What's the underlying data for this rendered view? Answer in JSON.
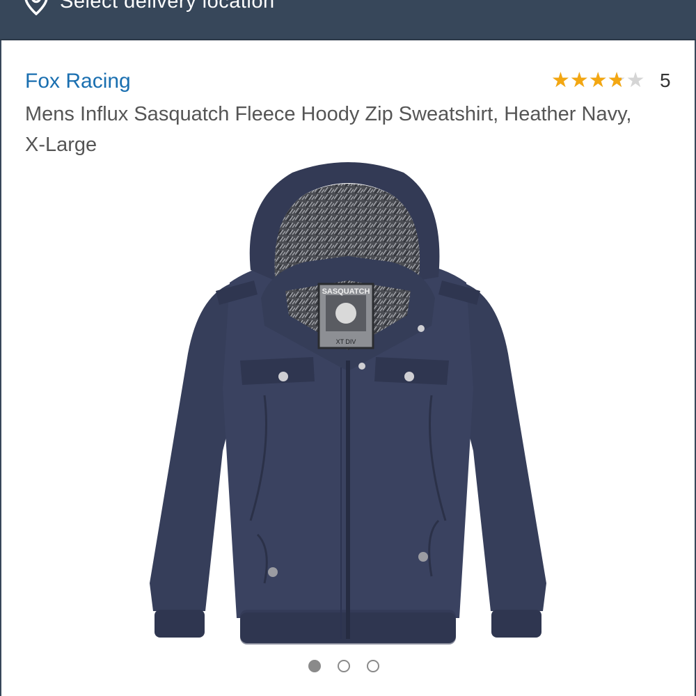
{
  "header": {
    "delivery_text": "Select delivery location",
    "icon": "location-pin-icon",
    "bg_color": "#37475a"
  },
  "product": {
    "brand": "Fox Racing",
    "title": "Mens Influx Sasquatch Fleece Hoody Zip Sweatshirt, Heather Navy, X-Large",
    "rating": 3.5,
    "rating_max": 5,
    "rating_count": "5",
    "image": {
      "label_top": "SASQUATCH",
      "label_bottom": "XT DIV"
    },
    "brand_color": "#1a6fb0",
    "star_color": "#f3a712"
  },
  "carousel": {
    "count": 3,
    "active_index": 0
  }
}
